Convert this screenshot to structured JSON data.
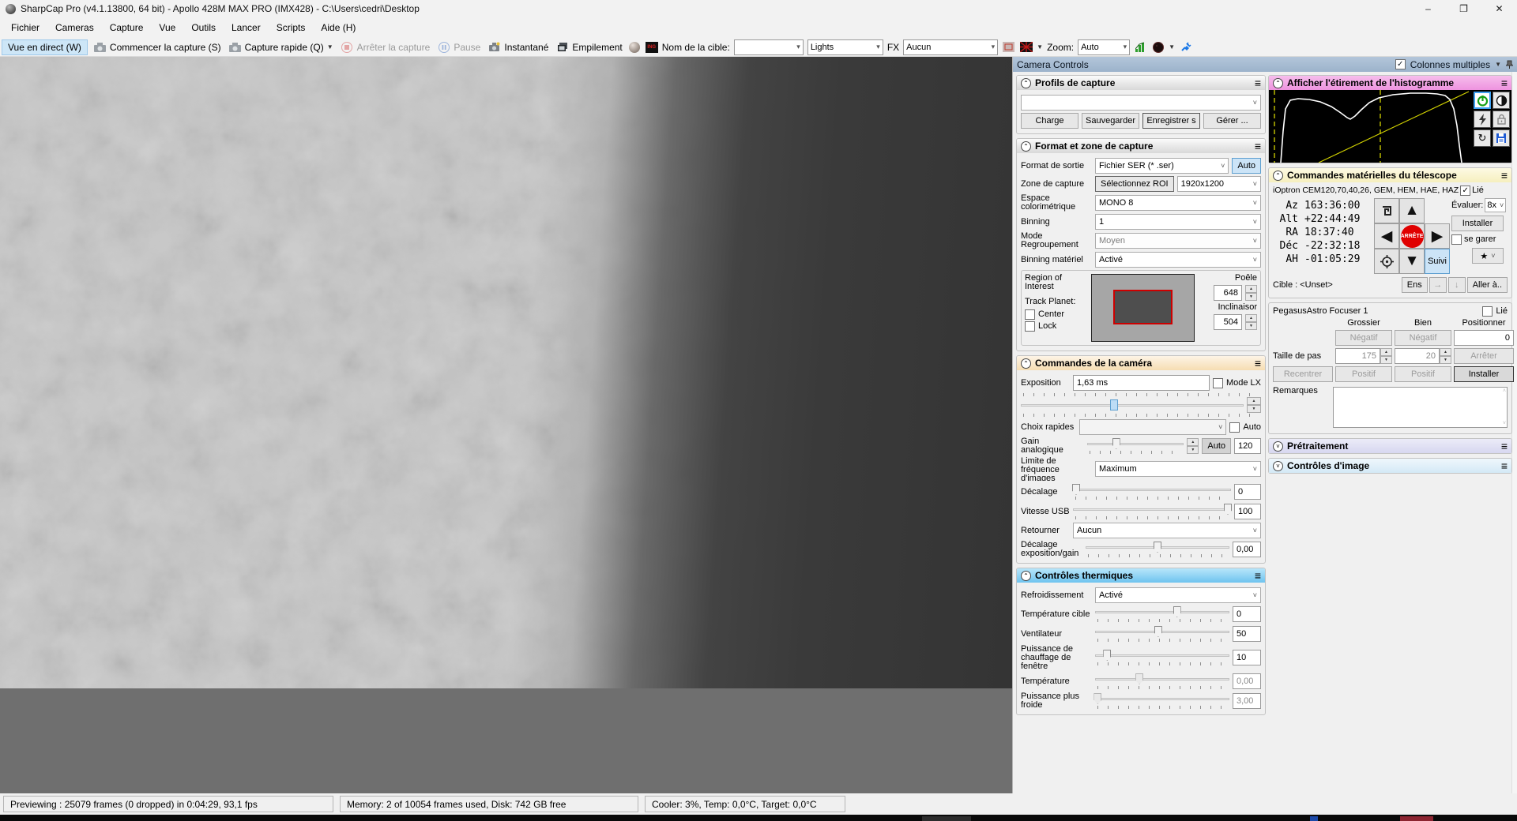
{
  "window": {
    "title": "SharpCap Pro (v4.1.13800, 64 bit) - Apollo 428M MAX PRO (IMX428) - C:\\Users\\cedri\\Desktop"
  },
  "menu": {
    "items": [
      "Fichier",
      "Cameras",
      "Capture",
      "Vue",
      "Outils",
      "Lancer",
      "Scripts",
      "Aide (H)"
    ]
  },
  "toolbar": {
    "live_view": "Vue en direct (W)",
    "start_capture": "Commencer la capture (S)",
    "quick_capture": "Capture rapide (Q)",
    "stop_capture": "Arrêter la capture",
    "pause": "Pause",
    "snapshot": "Instantané",
    "stack": "Empilement",
    "target_name_label": "Nom de la cible:",
    "frame_type": "Lights",
    "fx_label": "FX",
    "fx_value": "Aucun",
    "zoom_label": "Zoom:",
    "zoom_value": "Auto"
  },
  "panel": {
    "title": "Camera Controls",
    "multi_columns_label": "Colonnes multiples"
  },
  "profiles": {
    "title": "Profils de capture",
    "load": "Charge",
    "save": "Sauvegarder",
    "save_as": "Enregistrer s",
    "manage": "Gérer ..."
  },
  "format": {
    "title": "Format et zone de capture",
    "output_format_label": "Format de sortie",
    "output_format_value": "Fichier SER (* .ser)",
    "auto": "Auto",
    "capture_area_label": "Zone de capture",
    "select_roi": "Sélectionnez ROI",
    "capture_area_value": "1920x1200",
    "colour_space_label": "Espace colorimétrique",
    "colour_space_value": "MONO 8",
    "binning_label": "Binning",
    "binning_value": "1",
    "binning_mode_label": "Mode Regroupement",
    "binning_mode_value": "Moyen",
    "hw_binning_label": "Binning matériel",
    "hw_binning_value": "Activé",
    "roi_label": "Region of Interest",
    "track_planet_label": "Track Planet:",
    "center": "Center",
    "lock": "Lock",
    "pan_label": "Poêle",
    "pan_value": "648",
    "tilt_label": "Inclinaisor",
    "tilt_value": "504"
  },
  "camera": {
    "title": "Commandes de la caméra",
    "exposure_label": "Exposition",
    "exposure_value": "1,63 ms",
    "lx_mode": "Mode LX",
    "quick_picks_label": "Choix rapides",
    "auto": "Auto",
    "gain_label": "Gain analogique",
    "gain_auto": "Auto",
    "gain_value": "120",
    "framerate_label": "Limite de fréquence d'images",
    "framerate_value": "Maximum",
    "offset_label": "Décalage",
    "offset_value": "0",
    "usb_label": "Vitesse USB",
    "usb_value": "100",
    "flip_label": "Retourner",
    "flip_value": "Aucun",
    "eg_offset_label": "Décalage exposition/gain",
    "eg_offset_value": "0,00"
  },
  "thermal": {
    "title": "Contrôles thermiques",
    "cooling_label": "Refroidissement",
    "cooling_value": "Activé",
    "target_temp_label": "Température cible",
    "target_temp_value": "0",
    "fan_label": "Ventilateur",
    "fan_value": "50",
    "heater_label": "Puissance de chauffage de fenêtre",
    "heater_value": "10",
    "temp_label": "Température",
    "temp_value": "0,00",
    "cooler_label": "Puissance plus froide",
    "cooler_value": "3,00"
  },
  "histogram": {
    "title": "Afficher l'étirement de l'histogramme"
  },
  "telescope": {
    "title": "Commandes matérielles du télescope",
    "device": "iOptron CEM120,70,40,26, GEM, HEM, HAE, HAZ",
    "linked": "Lié",
    "coords": [
      {
        "label": "Az",
        "value": "163:36:00"
      },
      {
        "label": "Alt",
        "value": "+22:44:49"
      },
      {
        "label": "RA",
        "value": "18:37:40"
      },
      {
        "label": "Déc",
        "value": "-22:32:18"
      },
      {
        "label": "AH",
        "value": "-01:05:29"
      }
    ],
    "stop": "ARRÊTE",
    "rate_label": "Évaluer:",
    "rate_value": "8x",
    "install": "Installer",
    "park": "se garer",
    "tracking": "Suivi",
    "target": "Cible : <Unset>",
    "set": "Ens",
    "goto": "Aller à.."
  },
  "focuser": {
    "name": "PegasusAstro Focuser 1",
    "linked": "Lié",
    "coarse": "Grossier",
    "fine": "Bien",
    "position_label": "Positionner",
    "negative": "Négatif",
    "position_value": "0",
    "step_label": "Taille de pas",
    "coarse_step": "175",
    "fine_step": "20",
    "stop": "Arrêter",
    "recenter": "Recentrer",
    "positive": "Positif",
    "install": "Installer",
    "notes_label": "Remarques"
  },
  "extra_sections": {
    "preprocessing": "Prétraitement",
    "image_controls": "Contrôles d'image"
  },
  "statusbar": {
    "preview": "Previewing : 25079 frames (0 dropped) in 0:04:29, 93,1 fps",
    "memory": "Memory: 2 of 10054 frames used, Disk: 742 GB free",
    "cooler": "Cooler: 3%, Temp: 0,0°C, Target: 0,0°C"
  },
  "colors": {
    "accent_selected": "#cce4f7",
    "histogram_header": "#ee93df",
    "telescope_header": "#f6efbe",
    "camera_header": "#f6ddb2",
    "thermal_header": "#6ec3ef",
    "panel_titlebar": "#9cb3cb",
    "histogram_curve": "#ffffff",
    "histogram_line": "#d6d600",
    "stop_button": "#e00000"
  }
}
